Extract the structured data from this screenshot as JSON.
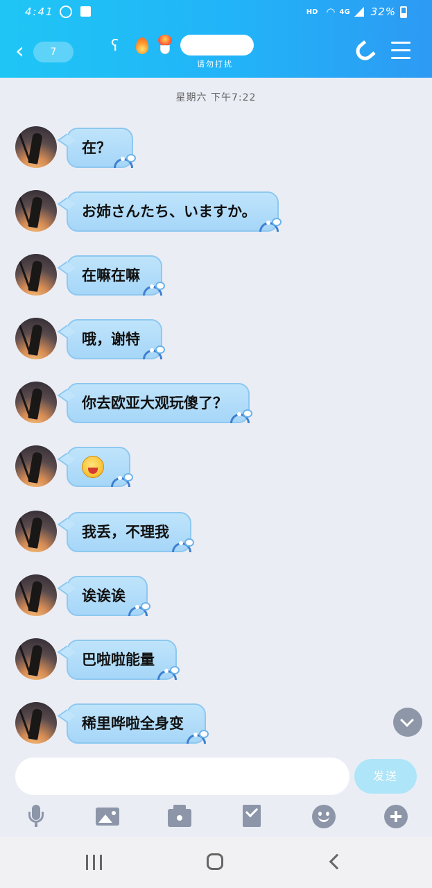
{
  "status_bar": {
    "time": "4:41",
    "hd": "HD",
    "network": "4G",
    "battery": "32%"
  },
  "header": {
    "back_badge": "7",
    "dnd_text": "请勿打扰",
    "icons": [
      "ear-icon",
      "fire-icon",
      "dessert-icon"
    ],
    "accent_color": "#22b3f8"
  },
  "chat": {
    "timestamp": "星期六 下午7:22",
    "messages": [
      {
        "text": "在？"
      },
      {
        "text": "お姉さんたち、いますか。"
      },
      {
        "text": "在嘛在嘛"
      },
      {
        "text": "哦，谢特"
      },
      {
        "text": "你去欧亚大观玩傻了？"
      },
      {
        "text": "",
        "emoji": "laughing-emoji"
      },
      {
        "text": "我丢，不理我"
      },
      {
        "text": "诶诶诶"
      },
      {
        "text": "巴啦啦能量"
      },
      {
        "text": "稀里哗啦全身变"
      }
    ],
    "bubble_color": "#bfe4fb"
  },
  "input": {
    "placeholder": "",
    "value": "",
    "send_label": "发送"
  },
  "toolbar": {
    "icons": [
      "microphone-icon",
      "image-icon",
      "camera-icon",
      "red-packet-icon",
      "emoji-icon",
      "plus-icon"
    ]
  }
}
